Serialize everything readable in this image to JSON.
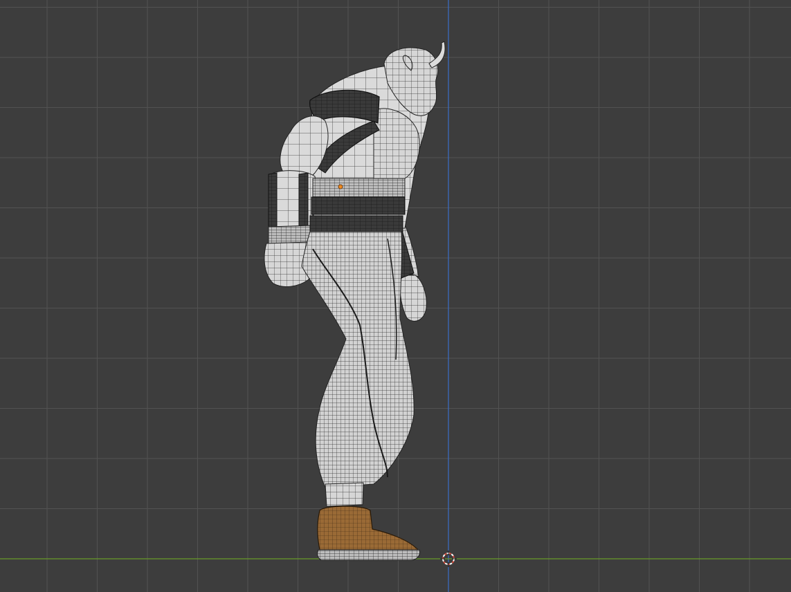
{
  "viewport": {
    "view": "side-orthographic",
    "background_color": "#3d3d3d",
    "grid_minor_color": "#474747",
    "grid_major_color": "#525252",
    "z_axis_color": "#3b6fc7",
    "y_axis_color": "#6a9c2a",
    "cursor_color": "#d94a3a",
    "origin_dot_color": "#f08a1e"
  },
  "model": {
    "description_icon": "character-mesh",
    "skin_color": "#cfcfcf",
    "wire_color": "#2a2a2a",
    "armor_color": "#2b2b2b",
    "boot_color": "#9a6a36",
    "sole_color": "#bdbdbd"
  }
}
